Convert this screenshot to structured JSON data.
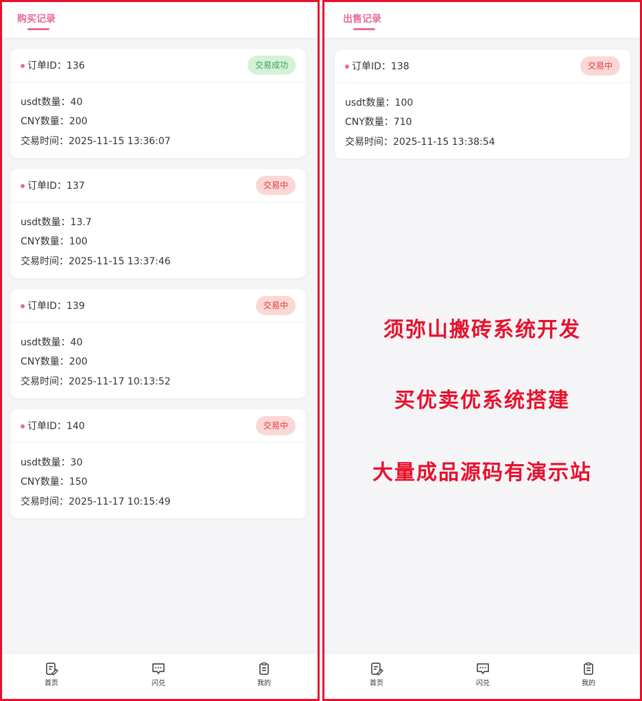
{
  "left": {
    "title": "购买记录",
    "orders": [
      {
        "id_label": "订单ID：136",
        "status": "交易成功",
        "status_type": "success",
        "usdt": "usdt数量：40",
        "cny": "CNY数量：200",
        "time": "交易时间：2025-11-15 13:36:07"
      },
      {
        "id_label": "订单ID：137",
        "status": "交易中",
        "status_type": "pending",
        "usdt": "usdt数量：13.7",
        "cny": "CNY数量：100",
        "time": "交易时间：2025-11-15 13:37:46"
      },
      {
        "id_label": "订单ID：139",
        "status": "交易中",
        "status_type": "pending",
        "usdt": "usdt数量：40",
        "cny": "CNY数量：200",
        "time": "交易时间：2025-11-17 10:13:52"
      },
      {
        "id_label": "订单ID：140",
        "status": "交易中",
        "status_type": "pending",
        "usdt": "usdt数量：30",
        "cny": "CNY数量：150",
        "time": "交易时间：2025-11-17 10:15:49"
      }
    ],
    "tabs": [
      {
        "label": "首页",
        "icon": "edit-doc-icon"
      },
      {
        "label": "闪兑",
        "icon": "chat-icon"
      },
      {
        "label": "我的",
        "icon": "clipboard-icon"
      }
    ]
  },
  "right": {
    "title": "出售记录",
    "orders": [
      {
        "id_label": "订单ID：138",
        "status": "交易中",
        "status_type": "pending",
        "usdt": "usdt数量：100",
        "cny": "CNY数量：710",
        "time": "交易时间：2025-11-15 13:38:54"
      }
    ],
    "promo": [
      "须弥山搬砖系统开发",
      "买优卖优系统搭建",
      "大量成品源码有演示站"
    ],
    "tabs": [
      {
        "label": "首页",
        "icon": "edit-doc-icon"
      },
      {
        "label": "闪兑",
        "icon": "chat-icon"
      },
      {
        "label": "我的",
        "icon": "clipboard-icon"
      }
    ]
  },
  "colors": {
    "accent": "#e96a9a",
    "frame": "#e8112d",
    "success_bg": "#d4f2d9",
    "success_text": "#39a34f",
    "pending_bg": "#fbd8d6",
    "pending_text": "#e23a3a"
  }
}
